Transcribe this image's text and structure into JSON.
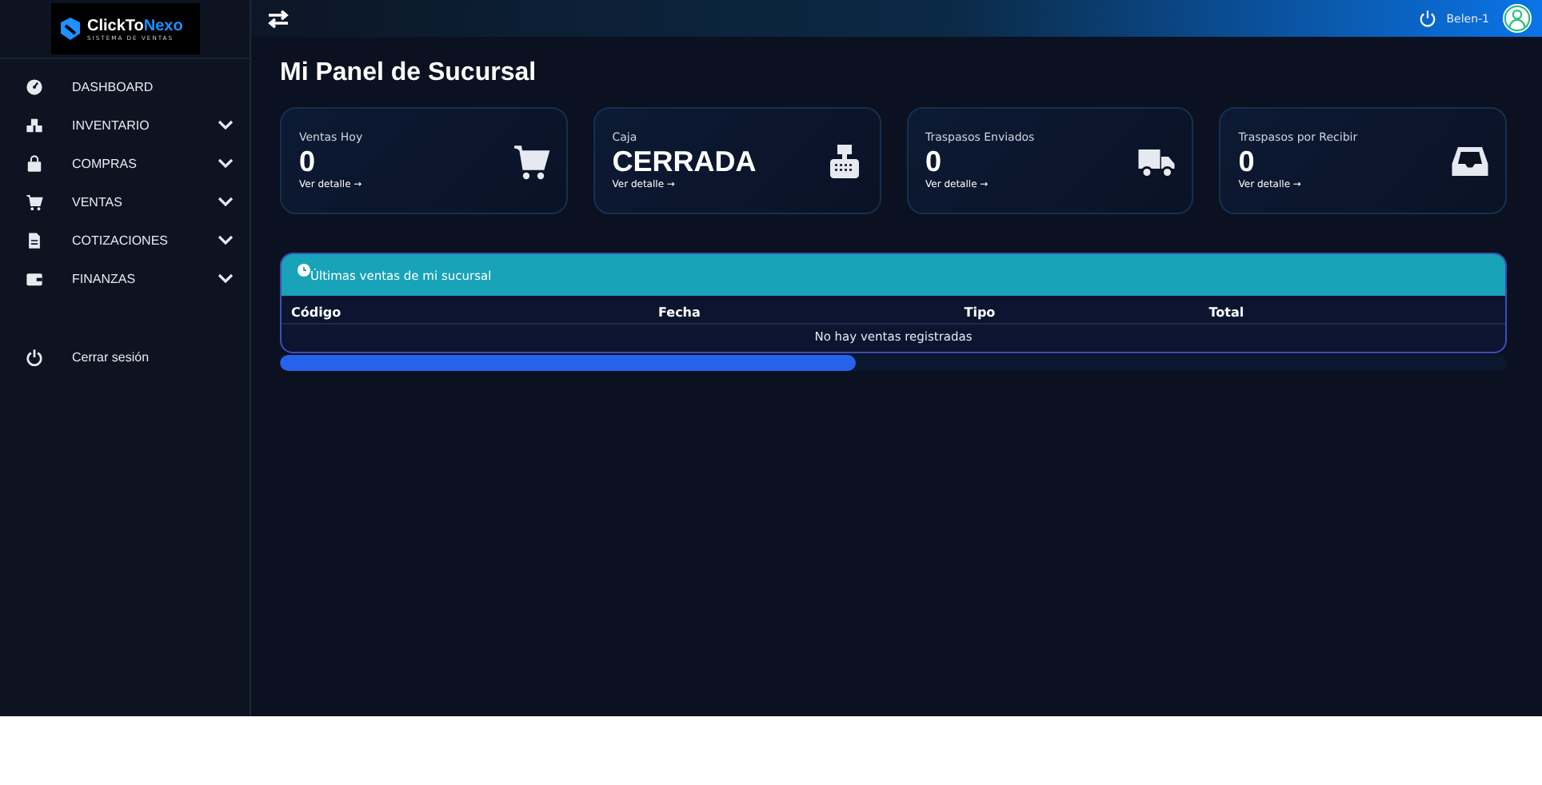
{
  "brand": {
    "name_part1": "ClickTo",
    "name_part2": "Nexo",
    "tagline": "SISTEMA DE VENTAS"
  },
  "sidebar": {
    "items": [
      {
        "label": "DASHBOARD",
        "expandable": false
      },
      {
        "label": "INVENTARIO",
        "expandable": true
      },
      {
        "label": "COMPRAS",
        "expandable": true
      },
      {
        "label": "VENTAS",
        "expandable": true
      },
      {
        "label": "COTIZACIONES",
        "expandable": true
      },
      {
        "label": "FINANZAS",
        "expandable": true
      }
    ],
    "logout": "Cerrar sesión"
  },
  "topbar": {
    "user": "Belen-1"
  },
  "page_title": "Mi Panel de Sucursal",
  "cards": [
    {
      "label": "Ventas Hoy",
      "value": "0",
      "link": "Ver detalle →"
    },
    {
      "label": "Caja",
      "value": "CERRADA",
      "link": "Ver detalle →"
    },
    {
      "label": "Traspasos Enviados",
      "value": "0",
      "link": "Ver detalle →"
    },
    {
      "label": "Traspasos por Recibir",
      "value": "0",
      "link": "Ver detalle →"
    }
  ],
  "sales_panel": {
    "title": "Últimas ventas de mi sucursal",
    "columns": [
      "Código",
      "Fecha",
      "Tipo",
      "Total"
    ],
    "empty_message": "No hay ventas registradas"
  }
}
